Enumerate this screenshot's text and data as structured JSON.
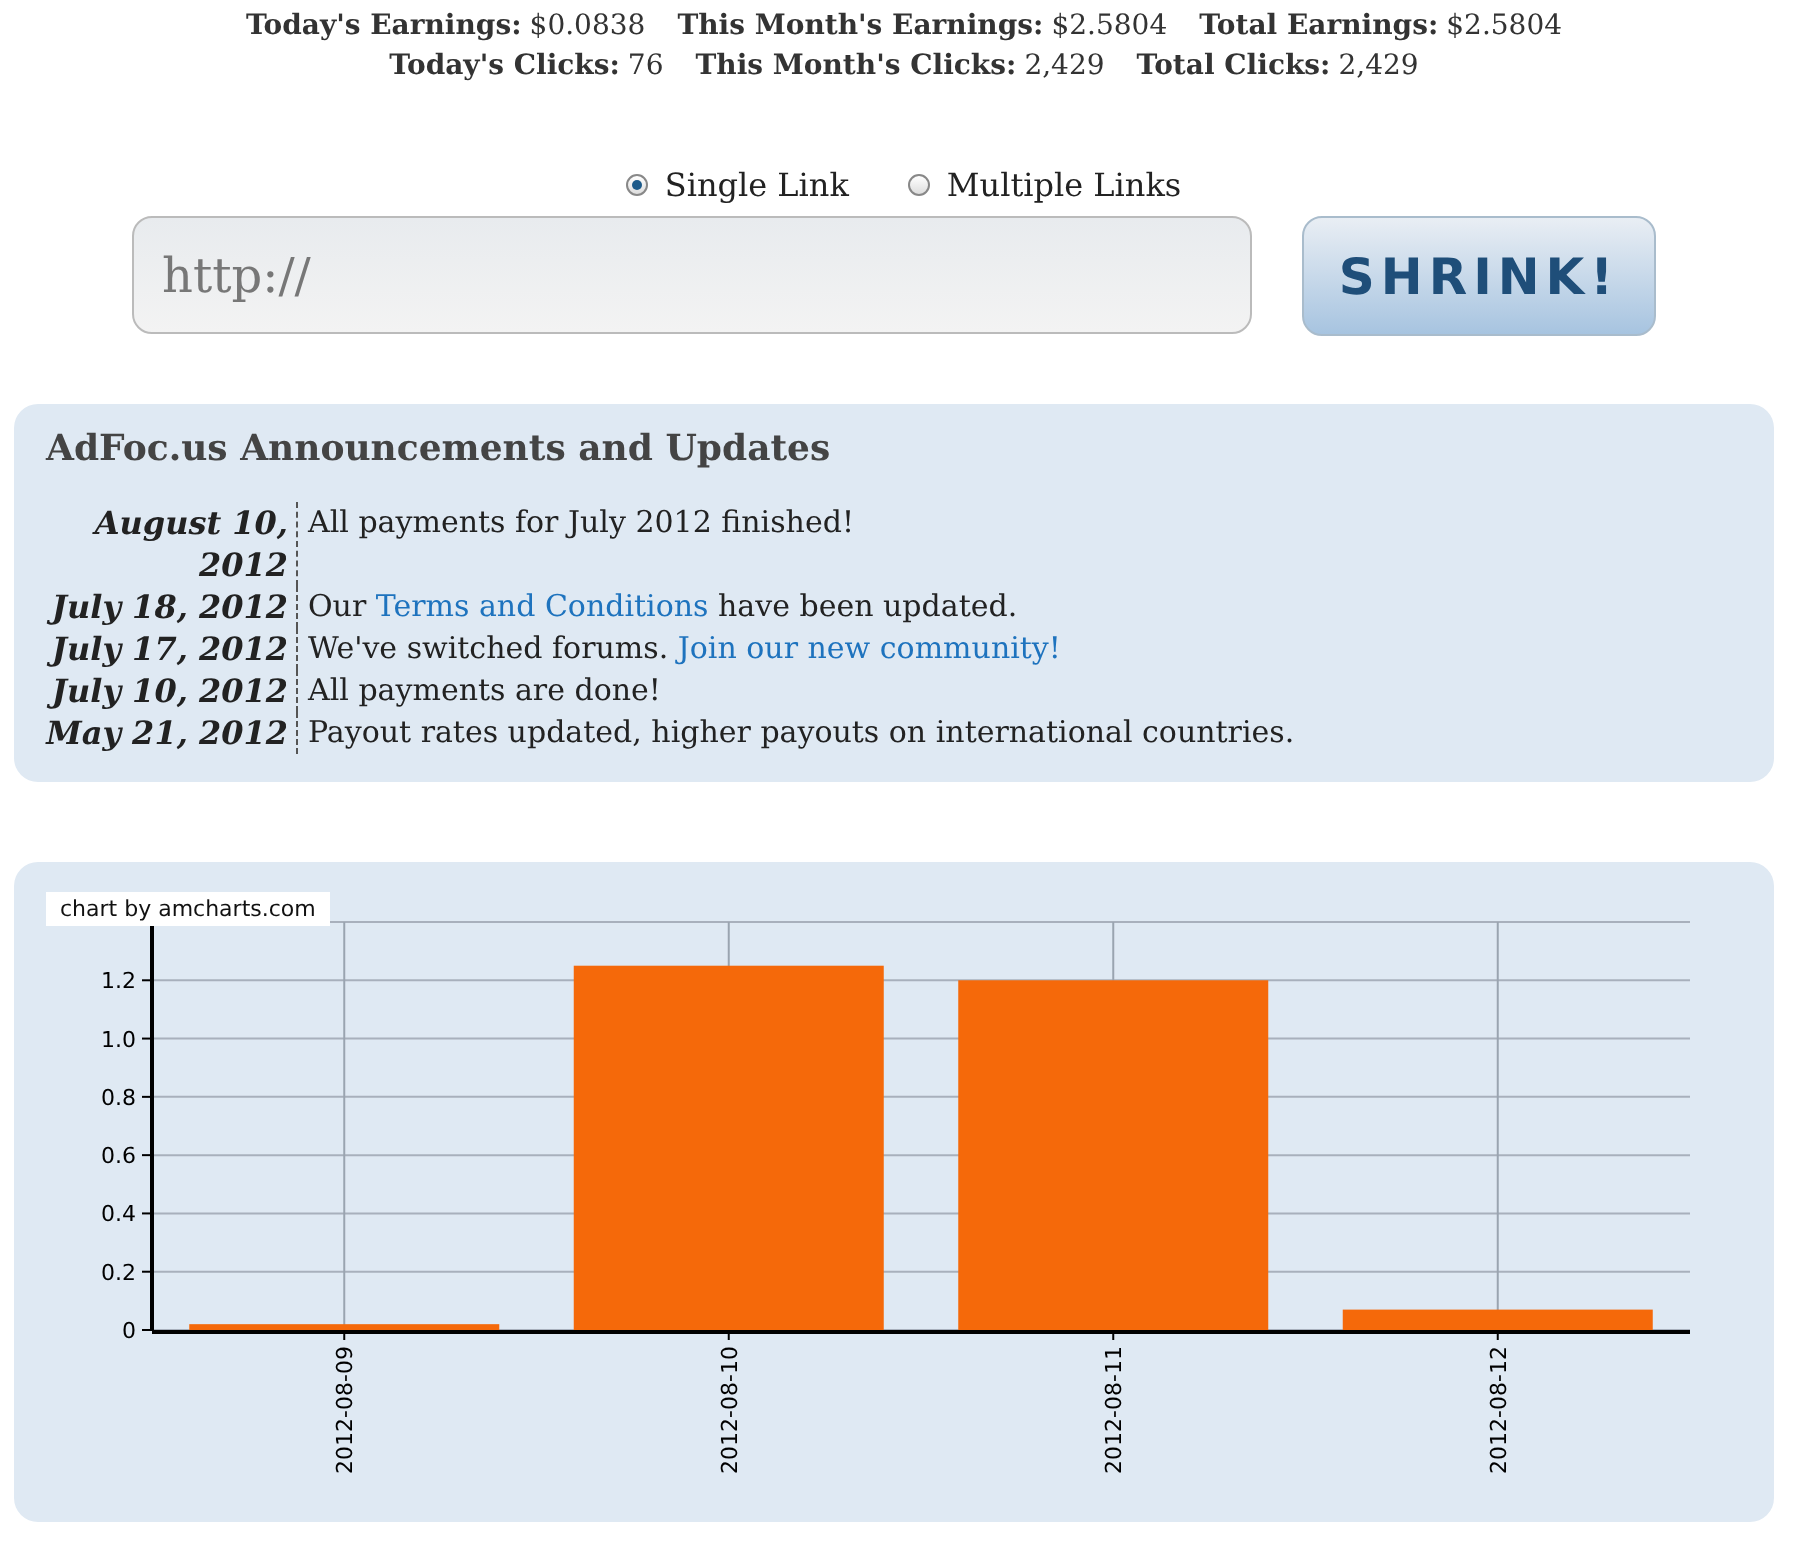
{
  "stats": [
    {
      "items": [
        {
          "label": "Today's Earnings:",
          "value": "$0.0838"
        },
        {
          "label": "This Month's Earnings:",
          "value": "$2.5804"
        },
        {
          "label": "Total Earnings:",
          "value": "$2.5804"
        }
      ]
    },
    {
      "items": [
        {
          "label": "Today's Clicks:",
          "value": "76"
        },
        {
          "label": "This Month's Clicks:",
          "value": "2,429"
        },
        {
          "label": "Total Clicks:",
          "value": "2,429"
        }
      ]
    }
  ],
  "link_mode": [
    {
      "label": "Single Link",
      "selected": true
    },
    {
      "label": "Multiple Links",
      "selected": false
    }
  ],
  "url_field": {
    "placeholder": "http://"
  },
  "shrink_button": "SHRINK!",
  "announcements": {
    "title": "AdFoc.us Announcements and Updates",
    "items": [
      {
        "date": "August 10, 2012",
        "parts": [
          {
            "text": "All payments for July 2012 finished!",
            "link": false
          }
        ]
      },
      {
        "date": "July 18, 2012",
        "parts": [
          {
            "text": "Our ",
            "link": false
          },
          {
            "text": "Terms and Conditions",
            "link": true
          },
          {
            "text": " have been updated.",
            "link": false
          }
        ]
      },
      {
        "date": "July 17, 2012",
        "parts": [
          {
            "text": "We've switched forums. ",
            "link": false
          },
          {
            "text": "Join our new community!",
            "link": true
          }
        ]
      },
      {
        "date": "July 10, 2012",
        "parts": [
          {
            "text": "All payments are done!",
            "link": false
          }
        ]
      },
      {
        "date": "May 21, 2012",
        "parts": [
          {
            "text": "Payout rates updated, higher payouts on international countries.",
            "link": false
          }
        ]
      }
    ]
  },
  "chart": {
    "credit": "chart by amcharts.com",
    "chart_data": {
      "type": "bar",
      "categories": [
        "2012-08-09",
        "2012-08-10",
        "2012-08-11",
        "2012-08-12"
      ],
      "series": [
        {
          "color": "#f5690a",
          "values": [
            0.02,
            1.25,
            1.2,
            0.07
          ]
        }
      ],
      "ylim": [
        0,
        1.4
      ],
      "grid": true,
      "yticks": [
        {
          "value": 0,
          "label": "0"
        },
        {
          "value": 0.2,
          "label": "0.2"
        },
        {
          "value": 0.4,
          "label": "0.4"
        },
        {
          "value": 0.6,
          "label": "0.6"
        },
        {
          "value": 0.8,
          "label": "0.8"
        },
        {
          "value": 1,
          "label": "1.0"
        },
        {
          "value": 1.2,
          "label": "1.2"
        }
      ]
    }
  }
}
